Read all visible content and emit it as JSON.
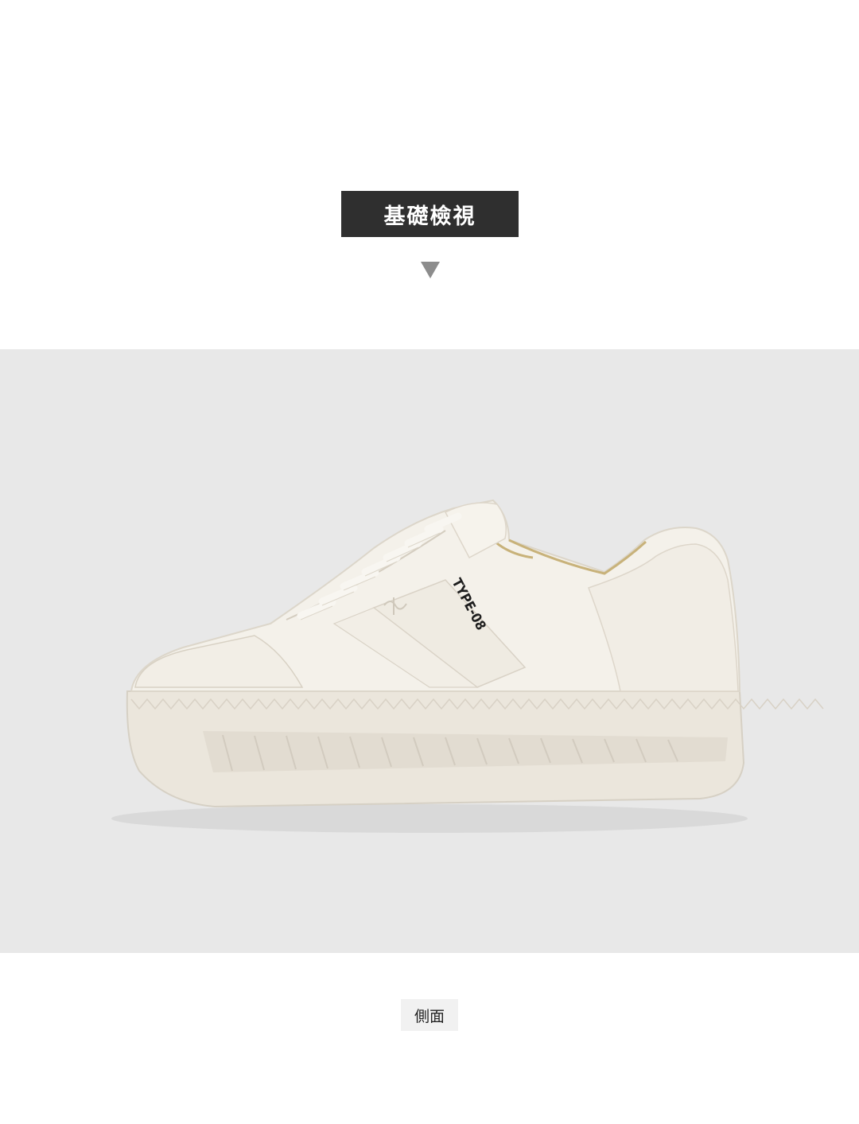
{
  "section": {
    "title": "基礎檢視",
    "header_bg": "#2f2f2f",
    "arrow_icon": "triangle-down-icon"
  },
  "product": {
    "model_label": "TYPE-08",
    "colors": {
      "background": "#e8e8e8",
      "upper": "#f3f0e8",
      "sole": "#ece7de",
      "accent_lining": "#c8b27a"
    }
  },
  "caption": {
    "view_label": "側面"
  }
}
